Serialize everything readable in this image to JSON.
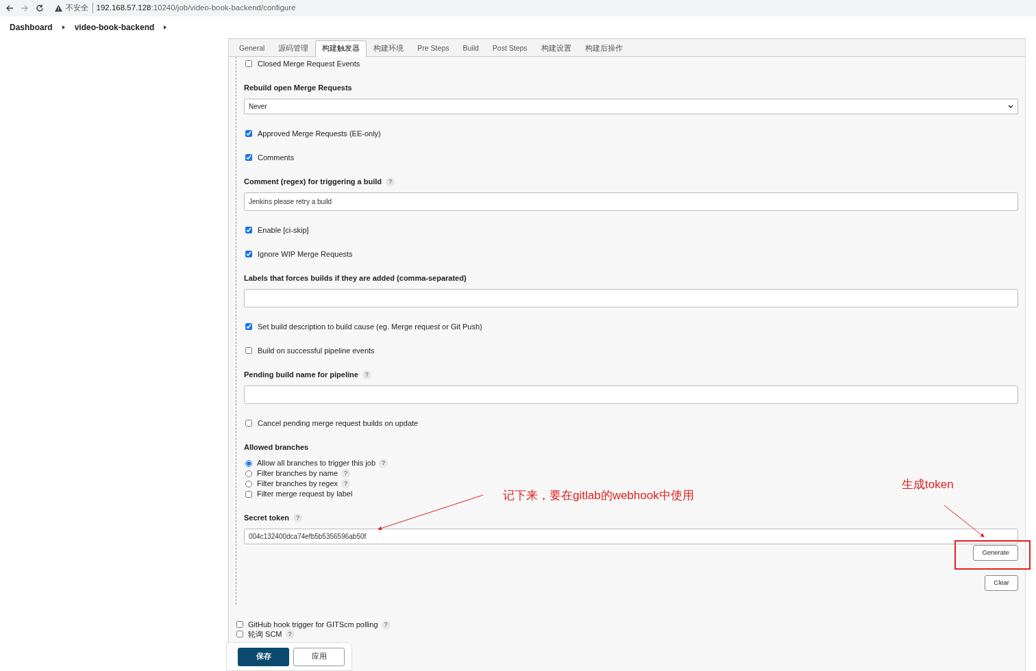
{
  "browser": {
    "security_label": "不安全",
    "url_host": "192.168.57.128",
    "url_path": ":10240/job/video-book-backend/configure"
  },
  "breadcrumbs": [
    {
      "label": "Dashboard"
    },
    {
      "label": "video-book-backend"
    }
  ],
  "tabs": [
    {
      "label": "General",
      "selected": false
    },
    {
      "label": "源码管理",
      "selected": false
    },
    {
      "label": "构建触发器",
      "selected": true
    },
    {
      "label": "构建环境",
      "selected": false
    },
    {
      "label": "Pre Steps",
      "selected": false
    },
    {
      "label": "Build",
      "selected": false
    },
    {
      "label": "Post Steps",
      "selected": false
    },
    {
      "label": "构建设置",
      "selected": false
    },
    {
      "label": "构建后操作",
      "selected": false
    }
  ],
  "trigger_options": [
    {
      "kind": "checkbox",
      "label": "Closed Merge Request Events",
      "checked": false
    },
    {
      "kind": "select",
      "label": "Rebuild open Merge Requests",
      "value": "Never"
    },
    {
      "kind": "checkbox",
      "label": "Approved Merge Requests (EE-only)",
      "checked": true
    },
    {
      "kind": "checkbox",
      "label": "Comments",
      "checked": true
    },
    {
      "kind": "text",
      "label": "Comment (regex) for triggering a build",
      "help": "?",
      "value": "Jenkins please retry a build"
    },
    {
      "kind": "checkbox",
      "label": "Enable [ci-skip]",
      "checked": true
    },
    {
      "kind": "checkbox",
      "label": "Ignore WIP Merge Requests",
      "checked": true
    },
    {
      "kind": "text",
      "label": "Labels that forces builds if they are added (comma-separated)"
    },
    {
      "kind": "checkbox",
      "label": "Set build description to build cause (eg. Merge request or Git Push)",
      "checked": true
    },
    {
      "kind": "checkbox",
      "label": "Build on successful pipeline events",
      "checked": false
    },
    {
      "kind": "text",
      "label": "Pending build name for pipeline",
      "help": "?"
    },
    {
      "kind": "checkbox",
      "label": "Cancel pending merge request builds on update",
      "checked": false
    },
    {
      "kind": "options",
      "label": "Allowed branches",
      "options": [
        {
          "kind": "radio",
          "label": "Allow all branches to trigger this job",
          "selected": true,
          "help": "?"
        },
        {
          "kind": "radio",
          "label": "Filter branches by name",
          "selected": false,
          "help": "?"
        },
        {
          "kind": "radio",
          "label": "Filter branches by regex",
          "selected": false,
          "help": "?"
        },
        {
          "kind": "checkbox",
          "label": "Filter merge request by label",
          "checked": false
        }
      ]
    },
    {
      "kind": "token",
      "label": "Secret token",
      "help": "?",
      "value": "004c132400dca74efb5b5356596ab50f",
      "buttons": [
        "Generate",
        "Clear"
      ]
    }
  ],
  "other_triggers": [
    {
      "label": "GitHub hook trigger for GITScm polling",
      "checked": false,
      "help": "?"
    },
    {
      "label": "轮询 SCM",
      "checked": false,
      "help": "?"
    }
  ],
  "footer_buttons": [
    {
      "label": "保存",
      "kind": "primary"
    },
    {
      "label": "应用",
      "kind": "secondary"
    }
  ],
  "annotations": [
    {
      "text": "记下来，要在gitlab的webhook中使用"
    },
    {
      "text": "生成token"
    }
  ]
}
